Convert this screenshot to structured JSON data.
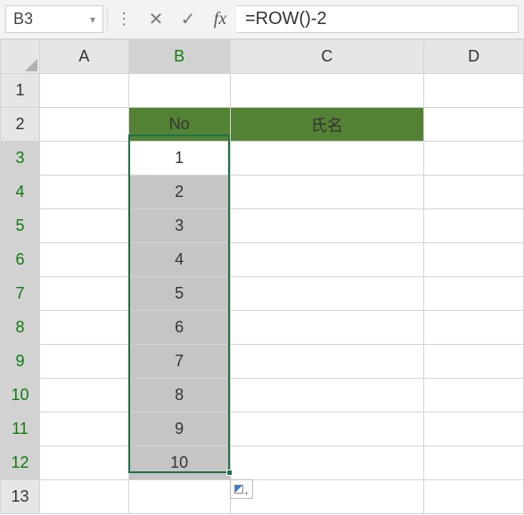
{
  "formula_bar": {
    "name_box": "B3",
    "formula": "=ROW()-2"
  },
  "columns": [
    "A",
    "B",
    "C",
    "D"
  ],
  "rows": [
    "1",
    "2",
    "3",
    "4",
    "5",
    "6",
    "7",
    "8",
    "9",
    "10",
    "11",
    "12",
    "13"
  ],
  "headers": {
    "no": "No",
    "name": "氏名"
  },
  "selection": {
    "active_cell": "B3",
    "range": "B3:B12",
    "col_selected": "B",
    "rows_selected": [
      3,
      4,
      5,
      6,
      7,
      8,
      9,
      10,
      11,
      12
    ]
  },
  "data": {
    "b3": "1",
    "b4": "2",
    "b5": "3",
    "b6": "4",
    "b7": "5",
    "b8": "6",
    "b9": "7",
    "b10": "8",
    "b11": "9",
    "b12": "10"
  },
  "colors": {
    "header_bg": "#548235",
    "selection_border": "#1f7246"
  },
  "chart_data": {
    "type": "table",
    "title": "",
    "columns": [
      "No",
      "氏名"
    ],
    "rows": [
      [
        1,
        ""
      ],
      [
        2,
        ""
      ],
      [
        3,
        ""
      ],
      [
        4,
        ""
      ],
      [
        5,
        ""
      ],
      [
        6,
        ""
      ],
      [
        7,
        ""
      ],
      [
        8,
        ""
      ],
      [
        9,
        ""
      ],
      [
        10,
        ""
      ]
    ]
  }
}
